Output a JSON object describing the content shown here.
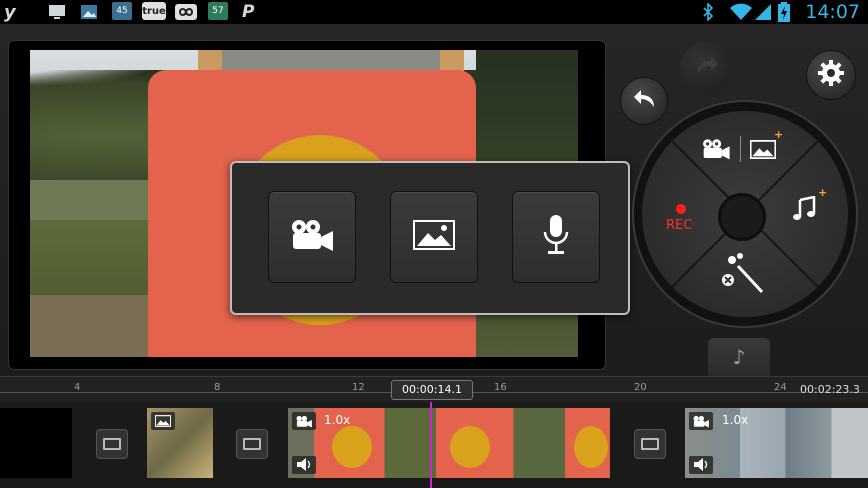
{
  "status_bar": {
    "icons": [
      "yahoo-icon",
      "screen-icon",
      "gallery-icon",
      "calendar-icon",
      "true-icon",
      "infinity-icon",
      "photo-icon",
      "paypal-icon",
      "bluetooth-icon",
      "wifi-icon",
      "signal-icon",
      "battery-icon"
    ],
    "badge_45": "45",
    "badge_true": "true",
    "badge_57": "57",
    "time": "14:07"
  },
  "popup": {
    "options": [
      "video-camera-icon",
      "image-icon",
      "microphone-icon"
    ]
  },
  "wheel": {
    "rec_label": "REC",
    "plus": "+"
  },
  "timeline": {
    "ruler_labels": [
      "4",
      "8",
      "12",
      "16",
      "20",
      "24"
    ],
    "current_time": "00:00:14.1",
    "total_time": "00:02:23.3",
    "clip1_speed": "1.0x",
    "clip2_speed": "1.0x"
  },
  "colors": {
    "accent_clock": "#33b5e5",
    "rec": "#ff1e1e",
    "plus": "#ffa726",
    "playhead": "#d21fd2"
  }
}
